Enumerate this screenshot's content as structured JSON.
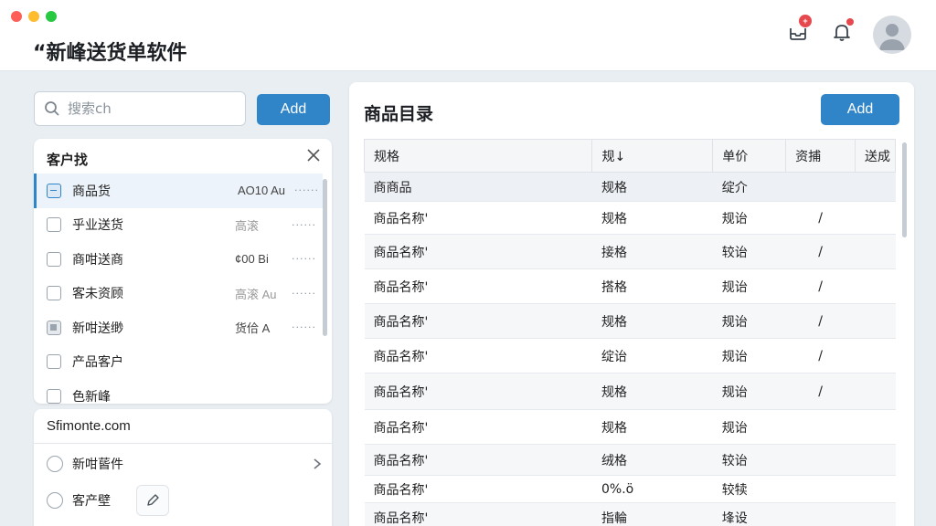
{
  "window": {
    "traffic_colors": [
      "#ff5f57",
      "#febc2e",
      "#28c840"
    ],
    "title": "“新峰送货单软件"
  },
  "header": {
    "inbox_icon": "inbox-icon",
    "inbox_badge": "+",
    "bell_icon": "bell-icon",
    "avatar_icon": "user-avatar-icon"
  },
  "sidebar": {
    "search": {
      "placeholder": "搜索ch",
      "icon": "search-icon"
    },
    "add_label": "Add",
    "customer_panel": {
      "title": "客户找",
      "close_icon": "close-icon",
      "items": [
        {
          "label": "商品货",
          "code": "AO10 Au",
          "dots": "······",
          "state": "checked-blue",
          "selected": true
        },
        {
          "label": "乎业送货",
          "code": "高滚",
          "dots": "······",
          "state": "unchecked",
          "selected": false
        },
        {
          "label": "商咁送商",
          "code": "¢00 Bi",
          "dots": "······",
          "state": "unchecked",
          "selected": false
        },
        {
          "label": "客未资顾",
          "code": "高滚 Au",
          "dots": "······",
          "state": "unchecked",
          "selected": false
        },
        {
          "label": "新咁送缈",
          "code": "货佮 A",
          "dots": "······",
          "state": "checked-gray",
          "selected": false
        },
        {
          "label": "产品客户",
          "code": "",
          "dots": "",
          "state": "unchecked",
          "selected": false
        },
        {
          "label": "色新峰",
          "code": "",
          "dots": "",
          "state": "unchecked",
          "selected": false
        }
      ]
    },
    "site_panel": {
      "title": "Sfimonte.com",
      "rows": [
        {
          "label": "新咁蒈件",
          "icon": "chevron-right-icon"
        },
        {
          "label": "客产壁",
          "icon": "edit-icon"
        }
      ]
    }
  },
  "catalog": {
    "title": "商品目录",
    "add_label": "Add",
    "columns": [
      "规格",
      "规↓",
      "单价",
      "资捕",
      "送成"
    ],
    "rows": [
      [
        "商商品",
        "规格",
        "绽介",
        "",
        ""
      ],
      [
        "商品名称'",
        "规格",
        "规诒",
        "/",
        ""
      ],
      [
        "商品名称'",
        "接格",
        "较诒",
        "/",
        ""
      ],
      [
        "商品名称'",
        "搭格",
        "规诒",
        "/",
        ""
      ],
      [
        "商品名称'",
        "规格",
        "规诒",
        "/",
        ""
      ],
      [
        "商品名称'",
        "绽诒",
        "规诒",
        "/",
        ""
      ],
      [
        "商品名称'",
        "规格",
        "规诒",
        "/",
        ""
      ],
      [
        "商品名称'",
        "规格",
        "规诒",
        "",
        ""
      ],
      [
        "商品名称'",
        "绒格",
        "较诒",
        "",
        ""
      ],
      [
        "商品名称'",
        "0%.ö",
        "较犊",
        "",
        ""
      ],
      [
        "商品名称'",
        "指輪",
        "埄设",
        "",
        ""
      ]
    ]
  }
}
